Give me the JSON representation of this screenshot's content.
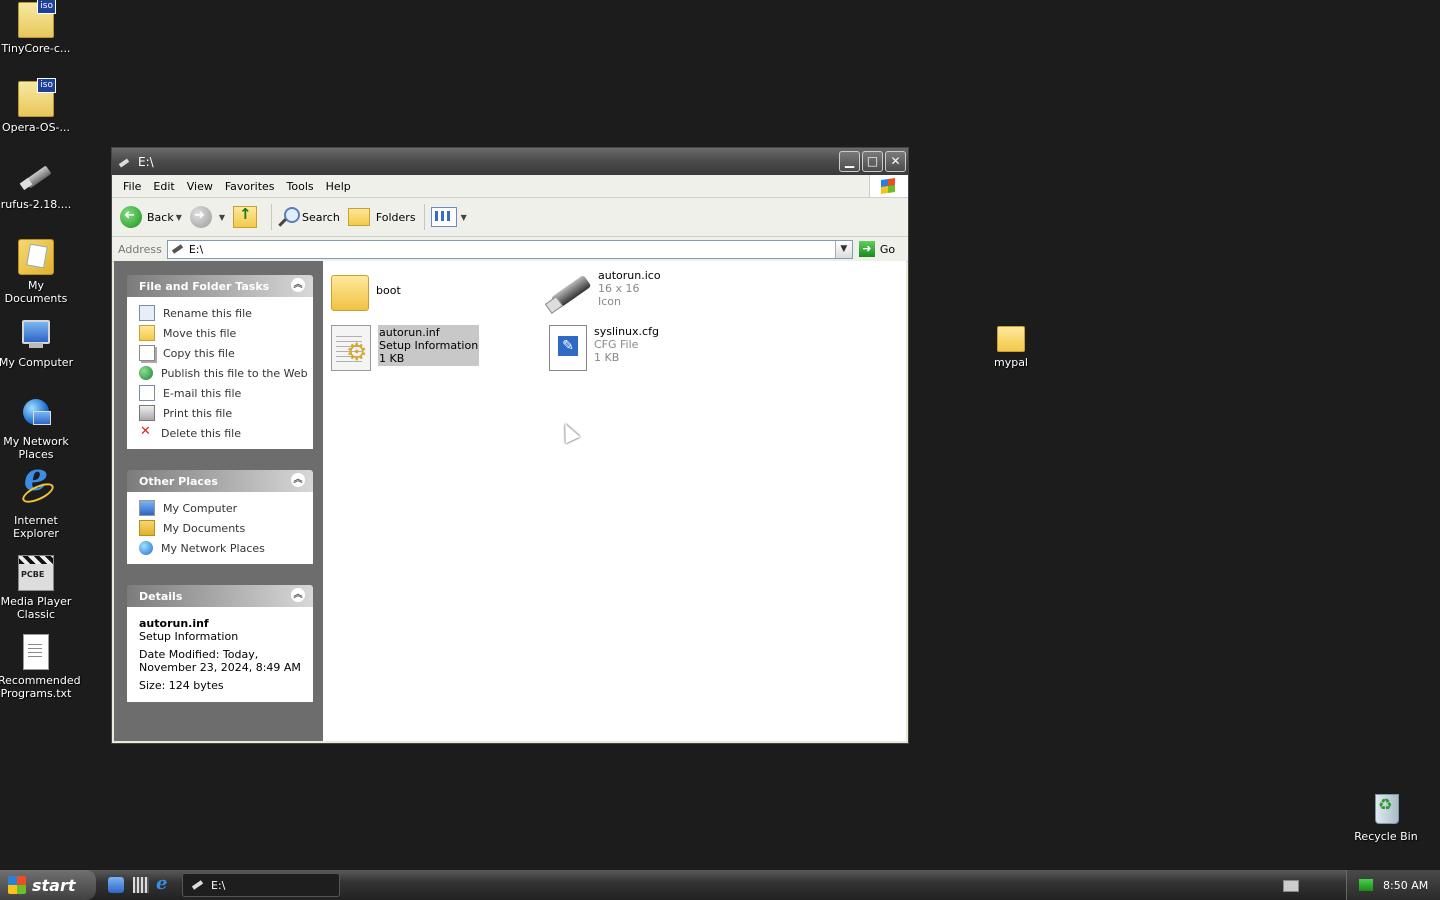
{
  "desktop": {
    "icons": [
      {
        "label": "TinyCore-c...",
        "icon": "iso-file-icon"
      },
      {
        "label": "Opera-OS-...",
        "icon": "iso-file-icon"
      },
      {
        "label": "rufus-2.18....",
        "icon": "usb-drive-icon"
      },
      {
        "label": "My Documents",
        "icon": "my-documents-icon"
      },
      {
        "label": "My Computer",
        "icon": "my-computer-icon"
      },
      {
        "label": "My Network Places",
        "icon": "network-places-icon"
      },
      {
        "label": "Internet Explorer",
        "icon": "internet-explorer-icon"
      },
      {
        "label": "Media Player Classic",
        "icon": "media-player-icon"
      },
      {
        "label": "Recommended Programs.txt",
        "icon": "text-file-icon"
      },
      {
        "label": "mypal",
        "icon": "folder-icon"
      },
      {
        "label": "Recycle Bin",
        "icon": "recycle-bin-icon"
      }
    ]
  },
  "window": {
    "title": "E:\\",
    "menu": [
      "File",
      "Edit",
      "View",
      "Favorites",
      "Tools",
      "Help"
    ],
    "toolbar": {
      "back": "Back",
      "search": "Search",
      "folders": "Folders"
    },
    "address": {
      "label": "Address",
      "value": "E:\\",
      "go": "Go"
    },
    "taskpane": {
      "file_tasks": {
        "title": "File and Folder Tasks",
        "items": [
          "Rename this file",
          "Move this file",
          "Copy this file",
          "Publish this file to the Web",
          "E-mail this file",
          "Print this file",
          "Delete this file"
        ]
      },
      "other_places": {
        "title": "Other Places",
        "items": [
          "My Computer",
          "My Documents",
          "My Network Places"
        ]
      },
      "details": {
        "title": "Details",
        "name": "autorun.inf",
        "type": "Setup Information",
        "modified_1": "Date Modified: Today,",
        "modified_2": "November 23, 2024, 8:49 AM",
        "size": "Size: 124 bytes"
      }
    },
    "files": [
      {
        "name": "boot",
        "line2": "",
        "line3": "",
        "icon": "folder-icon",
        "selected": false
      },
      {
        "name": "autorun.ico",
        "line2": "16 x 16",
        "line3": "Icon",
        "icon": "usb-drive-icon",
        "selected": false
      },
      {
        "name": "autorun.inf",
        "line2": "Setup Information",
        "line3": "1 KB",
        "icon": "setup-info-icon",
        "selected": true
      },
      {
        "name": "syslinux.cfg",
        "line2": "CFG File",
        "line3": "1 KB",
        "icon": "cfg-file-icon",
        "selected": false
      }
    ]
  },
  "taskbar": {
    "start": "start",
    "task_button": "E:\\",
    "clock": "8:50 AM"
  }
}
